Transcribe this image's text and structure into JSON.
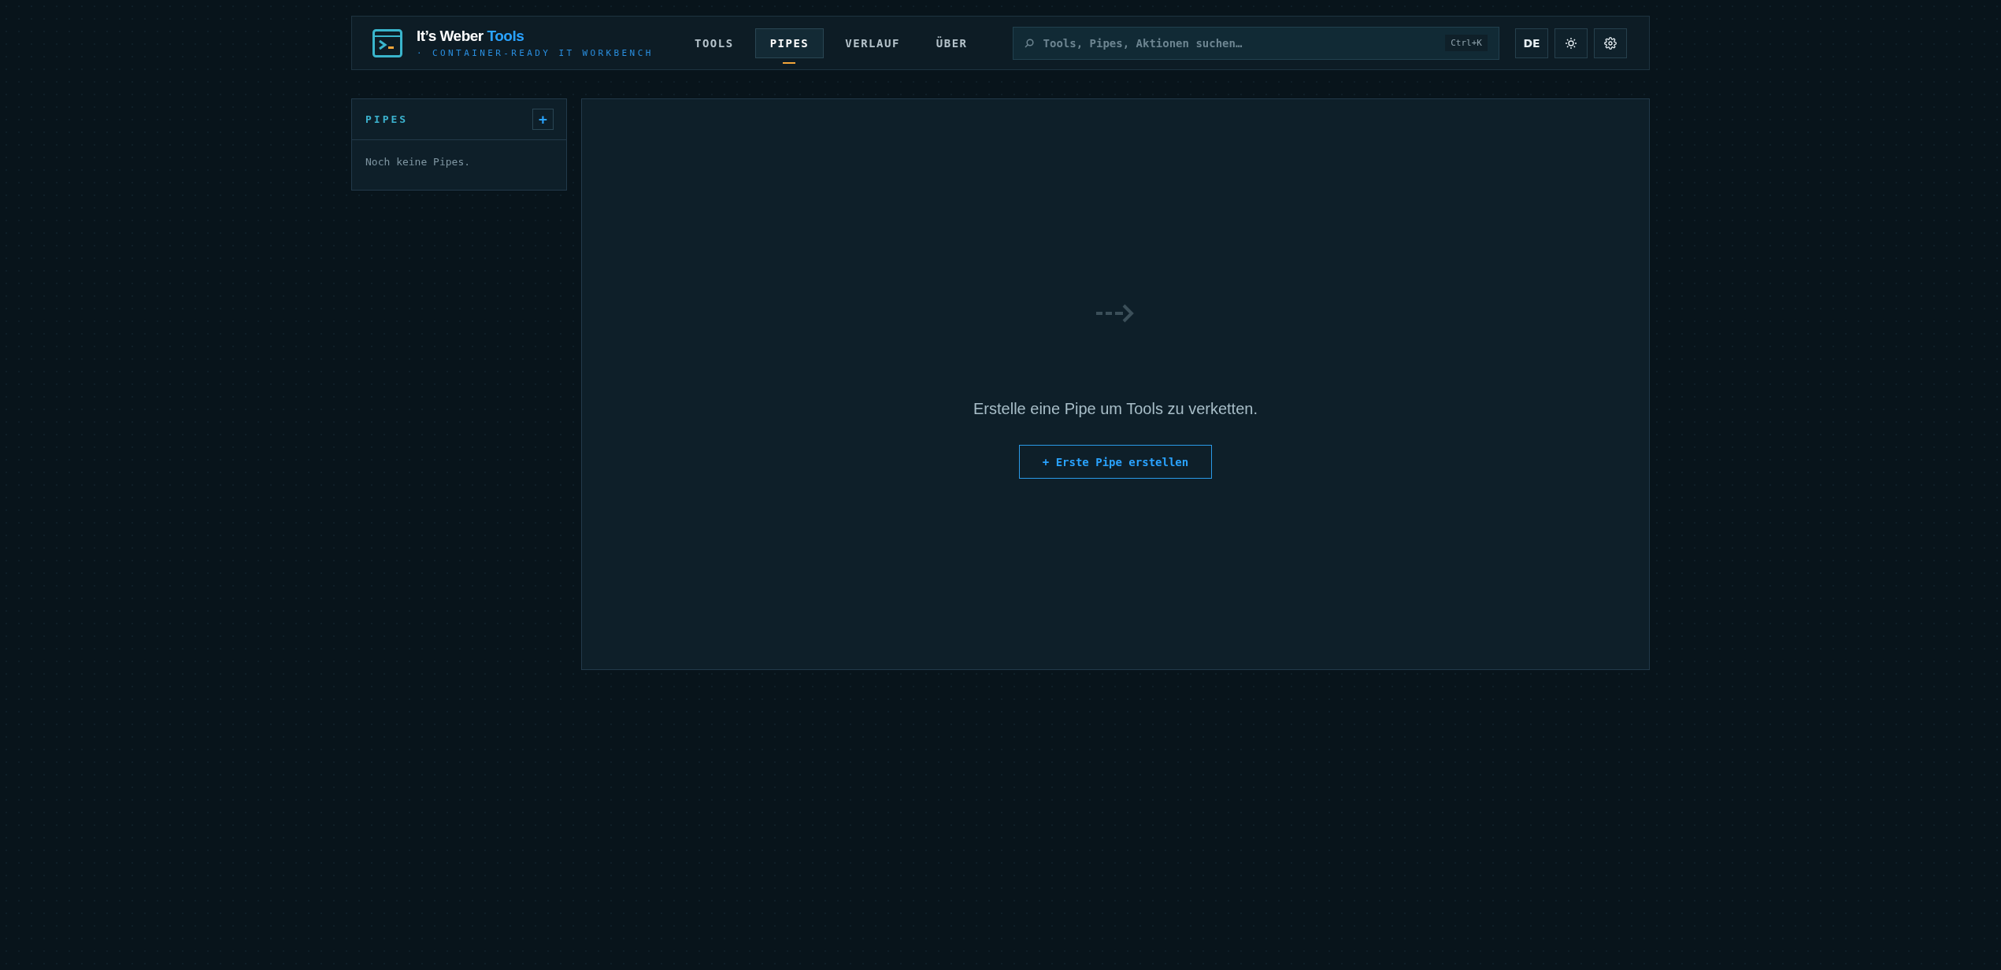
{
  "brand": {
    "name": "It’s Weber",
    "accent": "Tools",
    "tagline": "· CONTAINER-READY IT WORKBENCH"
  },
  "nav": [
    {
      "label": "TOOLS",
      "selected": false
    },
    {
      "label": "PIPES",
      "selected": true
    },
    {
      "label": "VERLAUF",
      "selected": false
    },
    {
      "label": "ÜBER",
      "selected": false
    }
  ],
  "search": {
    "placeholder": "Tools, Pipes, Aktionen suchen…",
    "shortcut": "Ctrl+K"
  },
  "language": "DE",
  "sidebar": {
    "title": "PIPES",
    "add_button": "+",
    "empty_text": "Noch keine Pipes."
  },
  "main": {
    "message": "Erstelle eine Pipe um Tools zu verketten.",
    "button": "+ Erste Pipe erstellen"
  }
}
